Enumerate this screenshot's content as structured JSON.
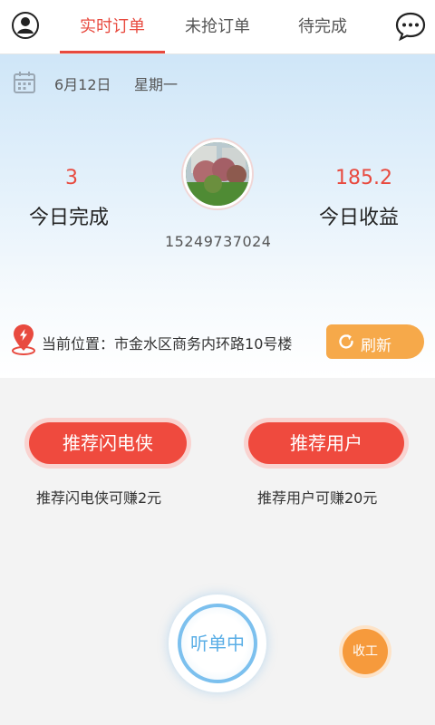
{
  "tabs": [
    {
      "label": "实时订单",
      "active": true
    },
    {
      "label": "未抢订单",
      "active": false
    },
    {
      "label": "待完成",
      "active": false
    }
  ],
  "icons": {
    "profile": "user-icon",
    "messages": "chat-bubble-icon",
    "calendar": "calendar-icon",
    "location": "location-pin-icon",
    "refresh": "refresh-icon"
  },
  "accent_color": "#e84a3f",
  "header": {
    "date": "6月12日",
    "weekday": "星期一",
    "completed_today": {
      "value": "3",
      "label": "今日完成"
    },
    "earnings_today": {
      "value": "185.2",
      "label": "今日收益"
    },
    "phone": "15249737024"
  },
  "location": {
    "label": "当前位置：",
    "address": "市金水区商务内环路10号楼"
  },
  "refresh_label": "刷新",
  "recommend": [
    {
      "button": "推荐闪电侠",
      "note": "推荐闪电侠可赚2元"
    },
    {
      "button": "推荐用户",
      "note": "推荐用户可赚20元"
    }
  ],
  "listen_label": "听单中",
  "close_work_label": "收工"
}
